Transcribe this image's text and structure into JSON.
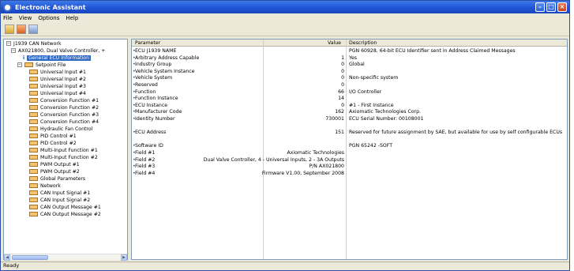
{
  "window": {
    "title": "Electronic Assistant",
    "buttons": [
      "–",
      "□",
      "×"
    ]
  },
  "menu": [
    "File",
    "View",
    "Options",
    "Help"
  ],
  "toolbar": [
    "open-icon",
    "save-icon",
    "print-icon"
  ],
  "tree": {
    "root": "J1939 CAN Network",
    "controller": "AX021800, Dual Valve Controller, +",
    "general": "General ECU Information",
    "setpoint_file": "Setpoint File",
    "items": [
      "Universal Input #1",
      "Universal Input #2",
      "Universal Input #3",
      "Universal Input #4",
      "Conversion Function #1",
      "Conversion Function #2",
      "Conversion Function #3",
      "Conversion Function #4",
      "Hydraulic Fan Control",
      "PID Control #1",
      "PID Control #2",
      "Multi-Input Function #1",
      "Multi-Input Function #2",
      "PWM Output #1",
      "PWM Output #2",
      "Global Parameters",
      "Network",
      "CAN Input Signal #1",
      "CAN Input Signal #2",
      "CAN Output Message #1",
      "CAN Output Message #2"
    ]
  },
  "grid": {
    "headers": {
      "parameter": "Parameter",
      "value": "Value",
      "description": "Description"
    },
    "rows": [
      {
        "p": "ECU J1939 NAME",
        "v": "",
        "d": "PGN 60928. 64-bit ECU Identifier sent in Address Claimed Messages"
      },
      {
        "p": "Arbitrary Address Capable",
        "v": "1",
        "d": "Yes"
      },
      {
        "p": "Industry Group",
        "v": "0",
        "d": "Global"
      },
      {
        "p": "Vehicle System Instance",
        "v": "0",
        "d": ""
      },
      {
        "p": "Vehicle System",
        "v": "0",
        "d": "Non-specific system"
      },
      {
        "p": "Reserved",
        "v": "0",
        "d": ""
      },
      {
        "p": "Function",
        "v": "66",
        "d": "I/O Controller"
      },
      {
        "p": "Function Instance",
        "v": "14",
        "d": ""
      },
      {
        "p": "ECU Instance",
        "v": "0",
        "d": "#1 - First Instance"
      },
      {
        "p": "Manufacturer Code",
        "v": "162",
        "d": "Axiomatic Technologies Corp."
      },
      {
        "p": "Identity Number",
        "v": "730001",
        "d": "ECU Serial Number: 00108001"
      },
      {
        "p": "",
        "v": "",
        "d": ""
      },
      {
        "p": "ECU Address",
        "v": "151",
        "d": "Reserved for future assignment by SAE, but available for use by self configurable ECUs"
      },
      {
        "p": "",
        "v": "",
        "d": ""
      },
      {
        "p": "Software ID",
        "v": "",
        "d": "PGN 65242  -SOFT"
      },
      {
        "p": "Field #1",
        "v": "Axiomatic Technologies",
        "d": ""
      },
      {
        "p": "Field #2",
        "v": "Dual Valve Controller, 4 - Universal Inputs, 2 - 3A Outputs",
        "d": ""
      },
      {
        "p": "Field #3",
        "v": "P/N AX021800",
        "d": ""
      },
      {
        "p": "Field #4",
        "v": "Firmware V1.00, September 2008",
        "d": ""
      }
    ]
  },
  "status": "Ready"
}
